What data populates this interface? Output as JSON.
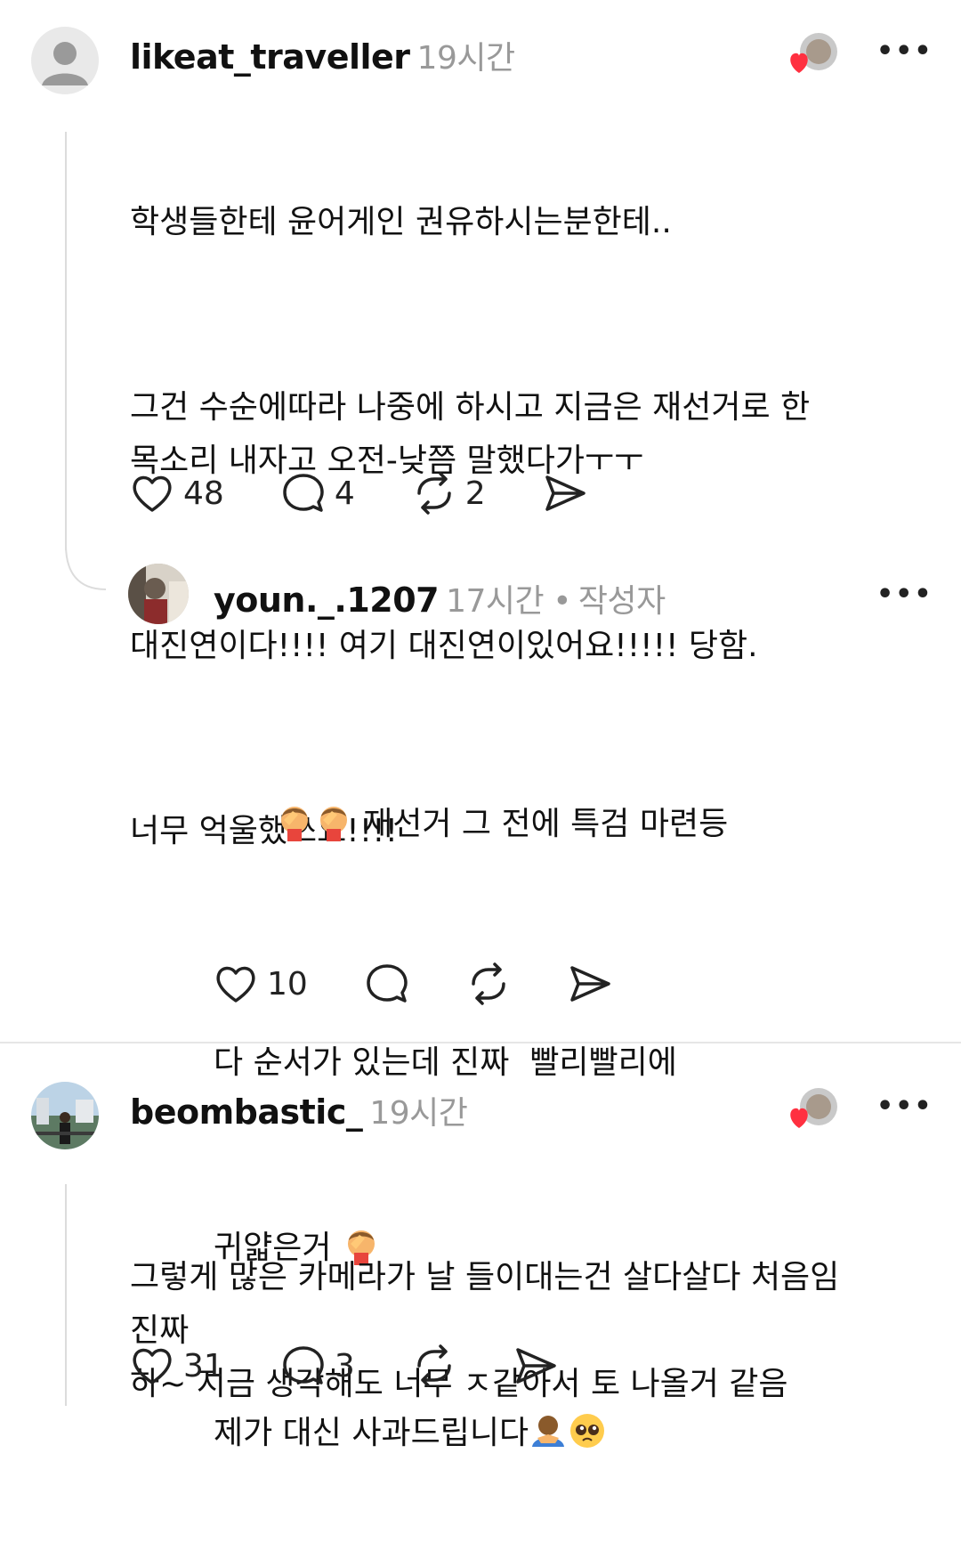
{
  "comments": [
    {
      "username": "likeat_traveller",
      "time": "19시간",
      "paragraphs": [
        "학생들한테 윤어게인 권유하시는분한테..",
        "그건 수순에따라 나중에 하시고 지금은 재선거로 한\n목소리 내자고 오전-낮쯤 말했다가ㅜㅜ",
        "대진연이다!!!! 여기 대진연이있어요!!!!! 당함.",
        "너무 억울했쓰요!!!!"
      ],
      "likes": "48",
      "replies": "4",
      "reposts": "2"
    },
    {
      "username": "youn._.1207",
      "time": "17시간",
      "author_tag": "작성자",
      "lines": [
        " 재선거 그 전에 특검 마련등",
        "다 순서가 있는데 진짜  빨리빨리에",
        "귀얇은거 ",
        "제가 대신 사과드립니다"
      ],
      "likes": "10"
    },
    {
      "username": "beombastic_",
      "time": "19시간",
      "text": "그렇게 많은 카메라가 날 들이대는건 살다살다 처음임\n진짜\n하~ 지금 생각해도 너무 ㅈ같아서 토 나올거 같음",
      "likes": "31",
      "replies": "3"
    }
  ],
  "icons": {
    "like": "heart-outline-icon",
    "reply": "speech-bubble-icon",
    "repost": "repost-arrows-icon",
    "share": "send-icon",
    "more": "more-dots-icon",
    "liked_by_author": "heart-badge-icon"
  },
  "colors": {
    "meta_gray": "#999999",
    "heart_red": "#ff3040",
    "divider": "#e6e6e6"
  }
}
